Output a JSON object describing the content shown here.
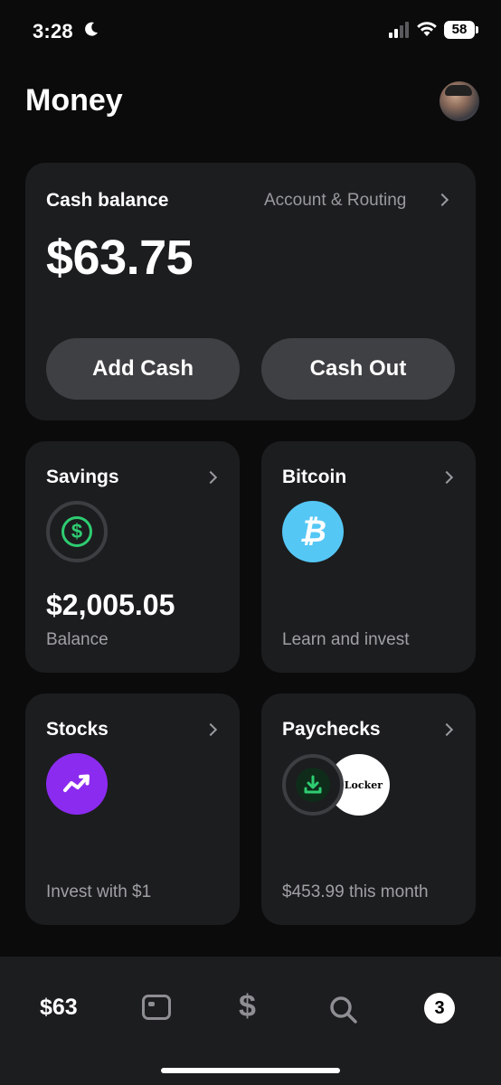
{
  "status_bar": {
    "time": "3:28",
    "battery": "58"
  },
  "header": {
    "title": "Money"
  },
  "cash_card": {
    "title": "Cash balance",
    "account_link": "Account & Routing",
    "amount": "$63.75",
    "add_cash_label": "Add Cash",
    "cash_out_label": "Cash Out"
  },
  "tiles": {
    "savings": {
      "title": "Savings",
      "value": "$2,005.05",
      "subtitle": "Balance",
      "icon": "dollar-circle-icon"
    },
    "bitcoin": {
      "title": "Bitcoin",
      "subtitle": "Learn and invest",
      "icon": "bitcoin-icon",
      "icon_glyph": "₿"
    },
    "stocks": {
      "title": "Stocks",
      "subtitle": "Invest with $1",
      "icon": "trend-up-icon"
    },
    "paychecks": {
      "title": "Paychecks",
      "subtitle": "$453.99 this month",
      "icon": "download-icon",
      "employer_logo": "ot Locker"
    }
  },
  "bottom_nav": {
    "balance": "$63",
    "dollar_glyph": "$",
    "activity_count": "3"
  },
  "colors": {
    "background": "#0b0b0c",
    "card": "#1c1d1f",
    "savings_green": "#2ecc71",
    "bitcoin_blue": "#55c7f5",
    "stocks_purple": "#8c2bf0",
    "button_gray": "#3f4043"
  }
}
